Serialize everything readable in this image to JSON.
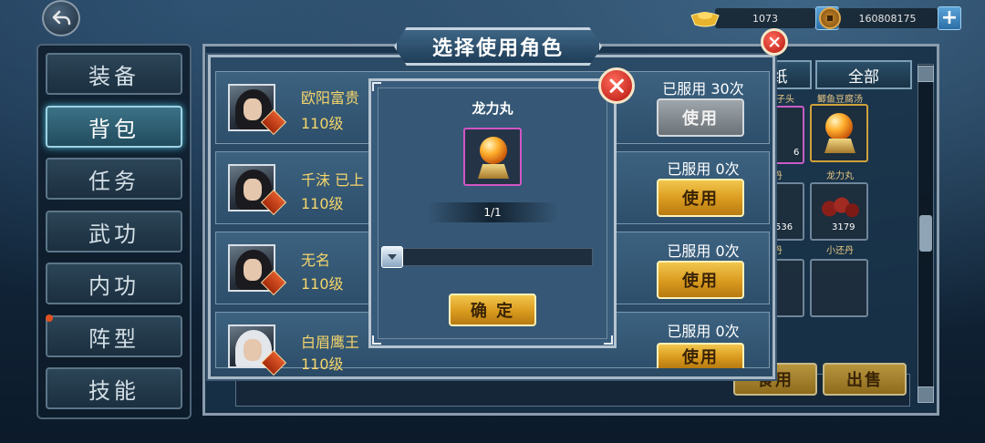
{
  "currency": {
    "ingot_value": "1073",
    "coin_value": "160808175"
  },
  "left_menu": {
    "items": [
      {
        "label": "装备"
      },
      {
        "label": "背包"
      },
      {
        "label": "任务"
      },
      {
        "label": "武功"
      },
      {
        "label": "内功"
      },
      {
        "label": "阵型"
      },
      {
        "label": "技能"
      }
    ],
    "active_index": 1
  },
  "inventory": {
    "tabs": [
      {
        "label": "纸"
      },
      {
        "label": "全部"
      }
    ],
    "items": [
      {
        "label": "子头",
        "count": "6"
      },
      {
        "label": "鲫鱼豆腐汤",
        "count": ""
      },
      {
        "label": "丹",
        "count": "536"
      },
      {
        "label": "龙力丸",
        "count": "3179"
      },
      {
        "label": "丹",
        "count": ""
      },
      {
        "label": "小还丹",
        "count": ""
      }
    ],
    "use_label": "食用",
    "sell_label": "出售"
  },
  "role_dialog": {
    "title": "选择使用角色",
    "roles": [
      {
        "name": "欧阳富贵",
        "level": "110级",
        "used": "已服用 30次",
        "button": "使用",
        "button_enabled": false
      },
      {
        "name": "千沫 已上",
        "level": "110级",
        "used": "已服用 0次",
        "button": "使用",
        "button_enabled": true
      },
      {
        "name": "无名",
        "level": "110级",
        "used": "已服用 0次",
        "button": "使用",
        "button_enabled": true
      },
      {
        "name": "白眉鹰王",
        "level": "110级",
        "used": "已服用 0次",
        "button": "使用",
        "button_enabled": true
      }
    ]
  },
  "item_popup": {
    "name": "龙力丸",
    "quantity": "1/1",
    "slider_fraction": 0,
    "confirm_label": "确 定"
  },
  "colors": {
    "gold_text": "#f5d56b",
    "accent_gold": "#d99a1e",
    "close_red": "#b4150b"
  }
}
